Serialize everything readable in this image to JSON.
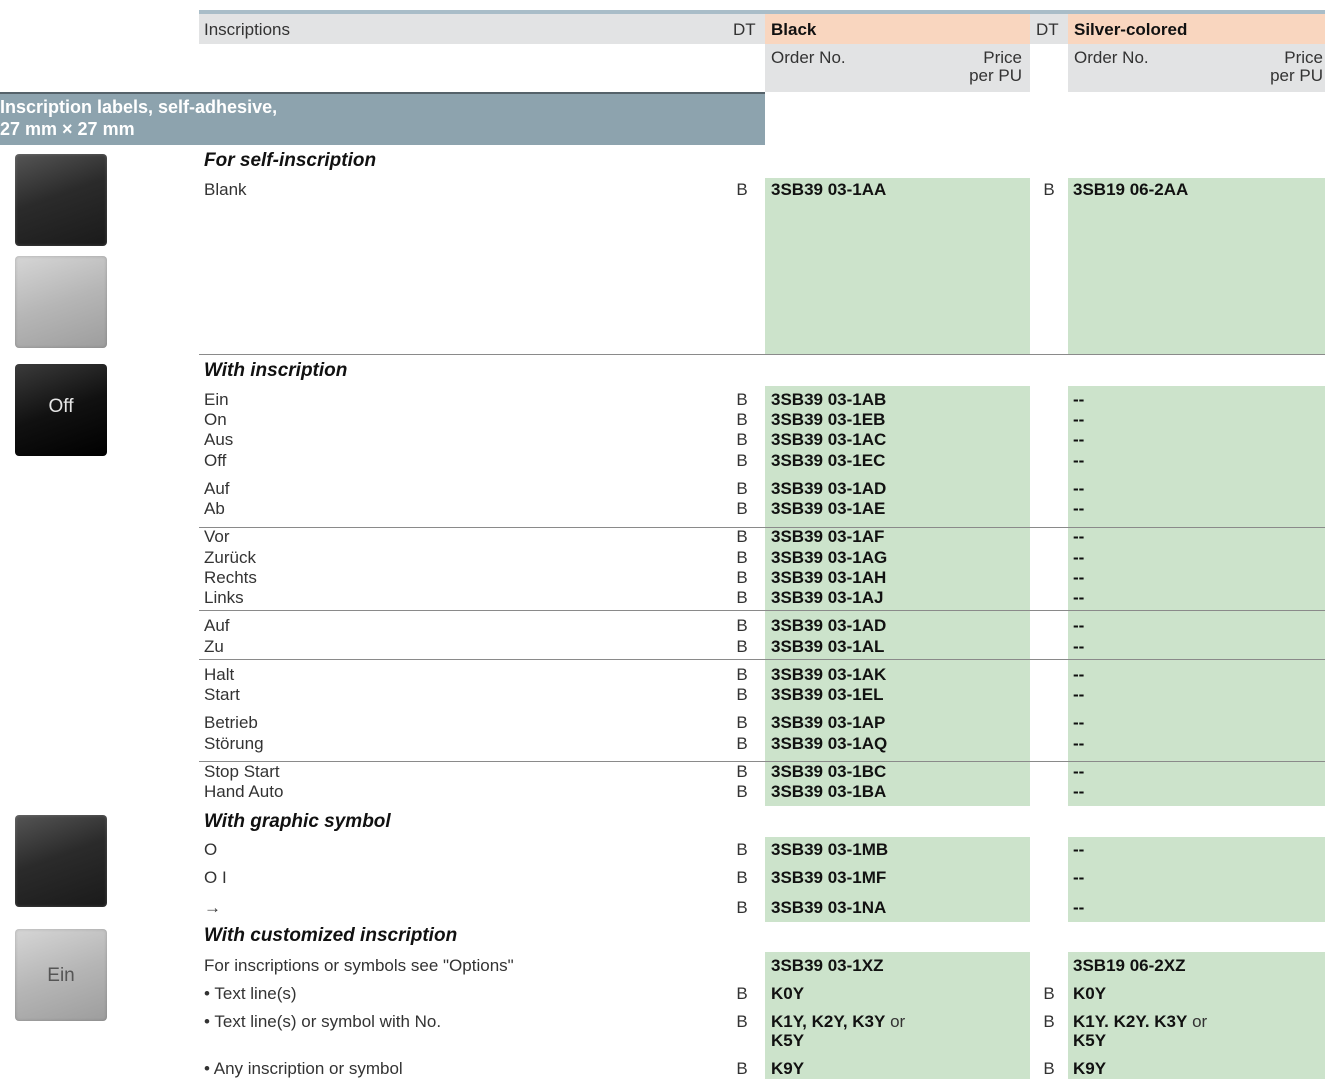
{
  "header": {
    "inscriptions": "Inscriptions",
    "dt": "DT",
    "black": "Black",
    "silver": "Silver-colored",
    "order_no": "Order No.",
    "price": "Price",
    "per_pu": "per PU"
  },
  "section": {
    "title_line1": "Inscription labels, self-adhesive,",
    "title_line2": "27 mm × 27 mm"
  },
  "thumbnails": {
    "off_label": "Off",
    "ein_label": "Ein"
  },
  "groups": {
    "self": "For self-inscription",
    "with_insc": "With inscription",
    "graphic": "With graphic symbol",
    "custom": "With customized inscription"
  },
  "self_rows": [
    {
      "label": "Blank",
      "dt1": "B",
      "black": "3SB39 03-1AA",
      "dt2": "B",
      "silver": "3SB19 06-2AA"
    }
  ],
  "insc_rows": [
    {
      "label": "Ein",
      "dt1": "B",
      "black": "3SB39 03-1AB",
      "silver": "--"
    },
    {
      "label": "On",
      "dt1": "B",
      "black": "3SB39 03-1EB",
      "silver": "--"
    },
    {
      "label": "Aus",
      "dt1": "B",
      "black": "3SB39 03-1AC",
      "silver": "--"
    },
    {
      "label": "Off",
      "dt1": "B",
      "black": "3SB39 03-1EC",
      "silver": "--"
    },
    {
      "label": "Auf",
      "dt1": "B",
      "black": "3SB39 03-1AD",
      "silver": "--"
    },
    {
      "label": "Ab",
      "dt1": "B",
      "black": "3SB39 03-1AE",
      "silver": "--"
    },
    {
      "label": "Vor",
      "dt1": "B",
      "black": "3SB39 03-1AF",
      "silver": "--"
    },
    {
      "label": "Zurück",
      "dt1": "B",
      "black": "3SB39 03-1AG",
      "silver": "--"
    },
    {
      "label": "Rechts",
      "dt1": "B",
      "black": "3SB39 03-1AH",
      "silver": "--"
    },
    {
      "label": "Links",
      "dt1": "B",
      "black": "3SB39 03-1AJ",
      "silver": "--"
    },
    {
      "label": "Auf",
      "dt1": "B",
      "black": "3SB39 03-1AD",
      "silver": "--"
    },
    {
      "label": "Zu",
      "dt1": "B",
      "black": "3SB39 03-1AL",
      "silver": "--"
    },
    {
      "label": "Halt",
      "dt1": "B",
      "black": "3SB39 03-1AK",
      "silver": "--"
    },
    {
      "label": "Start",
      "dt1": "B",
      "black": "3SB39 03-1EL",
      "silver": "--"
    },
    {
      "label": "Betrieb",
      "dt1": "B",
      "black": "3SB39 03-1AP",
      "silver": "--"
    },
    {
      "label": "Störung",
      "dt1": "B",
      "black": "3SB39 03-1AQ",
      "silver": "--"
    },
    {
      "label": "Stop Start",
      "dt1": "B",
      "black": "3SB39 03-1BC",
      "silver": "--"
    },
    {
      "label": "Hand Auto",
      "dt1": "B",
      "black": "3SB39 03-1BA",
      "silver": "--"
    }
  ],
  "graphic_rows": [
    {
      "label": "O",
      "dt1": "B",
      "black": "3SB39 03-1MB",
      "silver": "--"
    },
    {
      "label": "O I",
      "dt1": "B",
      "black": "3SB39 03-1MF",
      "silver": "--"
    },
    {
      "label": "→",
      "dt1": "B",
      "black": "3SB39 03-1NA",
      "silver": "--"
    }
  ],
  "custom_rows": [
    {
      "label": "For inscriptions or symbols see \"Options\"",
      "dt1": "",
      "black": "3SB39 03-1XZ",
      "dt2": "",
      "silver": "3SB19 06-2XZ"
    },
    {
      "label": "• Text line(s)",
      "dt1": "B",
      "black": "K0Y",
      "dt2": "B",
      "silver": "K0Y"
    },
    {
      "label": "• Text line(s) or symbol with No.",
      "dt1": "B",
      "black_a": "K1Y, K2Y, K3Y",
      "black_or": " or",
      "black_b": "K5Y",
      "dt2": "B",
      "silver_a": "K1Y. K2Y. K3Y",
      "silver_or": " or",
      "silver_b": "K5Y"
    },
    {
      "label": "• Any inscription or symbol",
      "dt1": "B",
      "black": "K9Y",
      "dt2": "B",
      "silver": "K9Y"
    }
  ]
}
